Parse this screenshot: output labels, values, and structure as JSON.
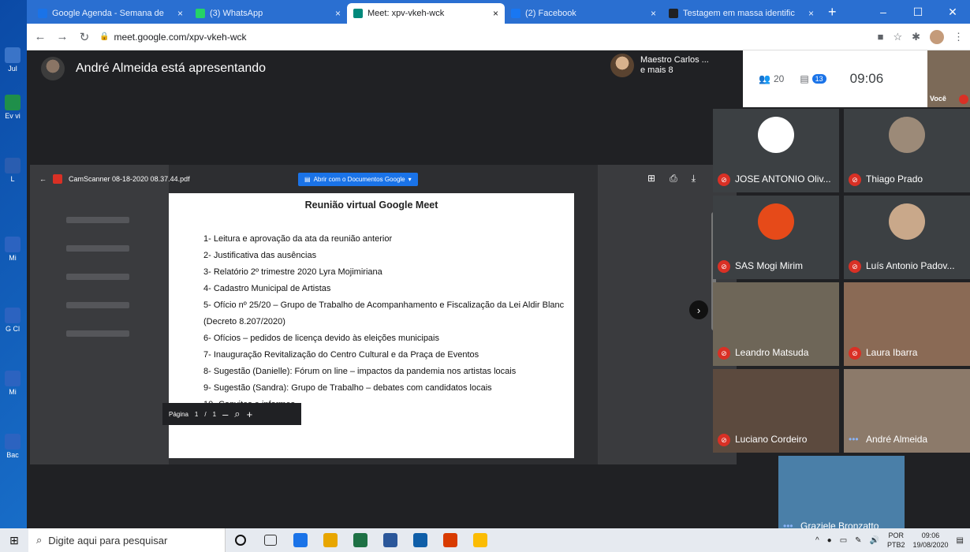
{
  "desktop": {
    "icons": [
      {
        "label": "Jul",
        "color": "#3a74c8"
      },
      {
        "label": "Ev vi",
        "color": "#1f8f4a"
      },
      {
        "label": "L",
        "color": "#2a5db0"
      },
      {
        "label": "Mi",
        "color": "#2c63c0"
      },
      {
        "label": "G Cl",
        "color": "#2c63c0"
      },
      {
        "label": "Mi",
        "color": "#2c63c0"
      },
      {
        "label": "Bac",
        "color": "#2c63c0"
      }
    ]
  },
  "browser": {
    "tabs": [
      {
        "label": "Google Agenda - Semana de",
        "favicon_color": "#1a73e8",
        "active": false
      },
      {
        "label": "(3) WhatsApp",
        "favicon_color": "#25d366",
        "active": false
      },
      {
        "label": "Meet: xpv-vkeh-wck",
        "favicon_color": "#00897b",
        "active": true
      },
      {
        "label": "(2) Facebook",
        "favicon_color": "#1877f2",
        "active": false
      },
      {
        "label": "Testagem em massa identific",
        "favicon_color": "#202124",
        "active": false
      }
    ],
    "new_tab": "+",
    "window_controls": {
      "minimize": "–",
      "maximize": "☐",
      "close": "✕"
    },
    "url": "meet.google.com/xpv-vkeh-wck"
  },
  "meet": {
    "presenter_text": "André Almeida está apresentando",
    "others": {
      "line1": "Maestro Carlos ...",
      "line2": "e mais 8"
    },
    "people_count": "20",
    "chat_badge": "13",
    "clock": "09:06",
    "self_label": "Você",
    "document": {
      "file_name": "CamScanner 08-18-2020 08.37.44.pdf",
      "open_with": "Abrir com o Documentos Google",
      "title": "Reunião virtual Google Meet",
      "items": [
        "1- Leitura e aprovação da ata da reunião anterior",
        "2- Justificativa das ausências",
        "3- Relatório 2º trimestre 2020 Lyra Mojimiriana",
        "4- Cadastro Municipal de Artistas",
        "5- Ofício nº 25/20 – Grupo de Trabalho de Acompanhamento e Fiscalização da Lei Aldir Blanc (Decreto 8.207/2020)",
        "6- Ofícios – pedidos de licença devido às eleições municipais",
        "7- Inauguração Revitalização do Centro Cultural e da Praça de Eventos",
        "8- Sugestão (Danielle): Fórum on line – impactos da pandemia nos artistas locais",
        "9- Sugestão (Sandra): Grupo de Trabalho – debates com candidatos locais",
        "10- Convites e informes"
      ],
      "pager": {
        "label": "Página",
        "current": "1",
        "sep": "/",
        "total": "1",
        "zoom_out": "–",
        "zoom_in": "+"
      }
    },
    "participants": [
      {
        "name": "JOSE ANTONIO Oliv...",
        "muted": true,
        "avatar_color": "#ffffff"
      },
      {
        "name": "Thiago Prado",
        "muted": true,
        "avatar_color": "#9c8a78"
      },
      {
        "name": "SAS Mogi Mirim",
        "muted": true,
        "avatar_color": "#e64a19"
      },
      {
        "name": "Luís Antonio Padov...",
        "muted": true,
        "avatar_color": "#c9a88a"
      },
      {
        "name": "Leandro Matsuda",
        "muted": true,
        "avatar_color": "#6e6658"
      },
      {
        "name": "Laura Ibarra",
        "muted": true,
        "avatar_color": "#8a6a55"
      },
      {
        "name": "Luciano Cordeiro",
        "muted": true,
        "avatar_color": "#5c4a3e"
      },
      {
        "name": "André Almeida",
        "muted": false,
        "avatar_color": "#8c7a6a"
      },
      {
        "name": "Graziele Bronzatto",
        "muted": false,
        "avatar_color": "#4a7fa8"
      }
    ]
  },
  "taskbar": {
    "search_placeholder": "Digite aqui para pesquisar",
    "apps": [
      "#1a73e8",
      "#e8a600",
      "#1e7145",
      "#2b579a",
      "#0f5ea8",
      "#d83b01",
      "#fbbc04"
    ],
    "lang": "POR",
    "lang2": "PTB2",
    "time": "09:06",
    "date": "19/08/2020"
  }
}
